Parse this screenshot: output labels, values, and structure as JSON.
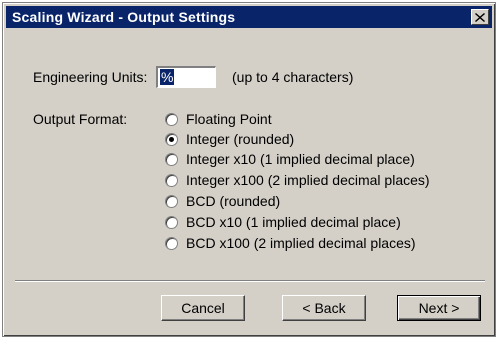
{
  "window": {
    "title": "Scaling Wizard - Output Settings",
    "close_glyph": "✕",
    "close_icon": "close-icon",
    "colors": {
      "title_bar": "#0a246a",
      "face": "#d4d0c8"
    }
  },
  "engineering_units": {
    "label": "Engineering Units:",
    "value": "%",
    "hint": "(up to 4 characters)"
  },
  "output_format": {
    "label": "Output Format:",
    "selected_index": 1,
    "options": [
      {
        "label": "Floating Point",
        "checked": false
      },
      {
        "label": "Integer (rounded)",
        "checked": true
      },
      {
        "label": "Integer x10 (1 implied decimal place)",
        "checked": false
      },
      {
        "label": "Integer x100 (2 implied decimal places)",
        "checked": false
      },
      {
        "label": "BCD (rounded)",
        "checked": false
      },
      {
        "label": "BCD x10 (1 implied decimal place)",
        "checked": false
      },
      {
        "label": "BCD x100 (2 implied decimal places)",
        "checked": false
      }
    ]
  },
  "buttons": {
    "cancel": "Cancel",
    "back": "< Back",
    "next": "Next >"
  }
}
